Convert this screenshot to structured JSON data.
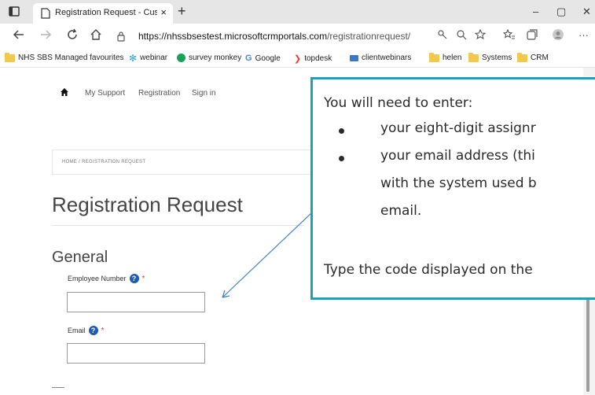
{
  "browser": {
    "tab_title": "Registration Request - Customer",
    "tab_close": "×",
    "new_tab": "+",
    "url_host": "https://nhssbsestest.microsoftcrmportals.com",
    "url_path": "/registrationrequest/",
    "window_controls": {
      "minimize": "–",
      "maximize": "▢",
      "close": "✕"
    },
    "more": "···"
  },
  "favourites": [
    {
      "label": "NHS SBS Managed favourites",
      "icon": "folder-icon",
      "color": "#f2c94c"
    },
    {
      "label": "webinar",
      "icon": "snowflake-icon",
      "color": "#2fa3e6"
    },
    {
      "label": "survey monkey",
      "icon": "surveymonkey-icon",
      "color": "#19a35a"
    },
    {
      "label": "Google",
      "icon": "google-icon",
      "color": "#4285f4"
    },
    {
      "label": "topdesk",
      "icon": "topdesk-icon",
      "color": "#e8412c"
    },
    {
      "label": "clientwebinars",
      "icon": "webinar-icon",
      "color": "#3a78c9"
    },
    {
      "label": "helen",
      "icon": "folder-icon",
      "color": "#f2c94c"
    },
    {
      "label": "Systems",
      "icon": "folder-icon",
      "color": "#f2c94c"
    },
    {
      "label": "CRM",
      "icon": "folder-icon",
      "color": "#f2c94c"
    }
  ],
  "portal_nav": {
    "my_support": "My Support",
    "registration": "Registration",
    "sign_in": "Sign in"
  },
  "breadcrumb": "HOME / REGISTRATION REQUEST",
  "page_title": "Registration Request",
  "section_title": "General",
  "fields": {
    "employee_number": {
      "label": "Employee Number",
      "required": "*",
      "value": ""
    },
    "email": {
      "label": "Email",
      "required": "*",
      "value": ""
    }
  },
  "callout": {
    "intro": "You will need to enter:",
    "bullet1": "your eight-digit assignr",
    "bullet2_line1": "your email address (thi",
    "bullet2_line2": "with the system used b",
    "bullet2_line3": "email.",
    "outro": "Type the code displayed on the",
    "border_color": "#1aa3b8"
  }
}
